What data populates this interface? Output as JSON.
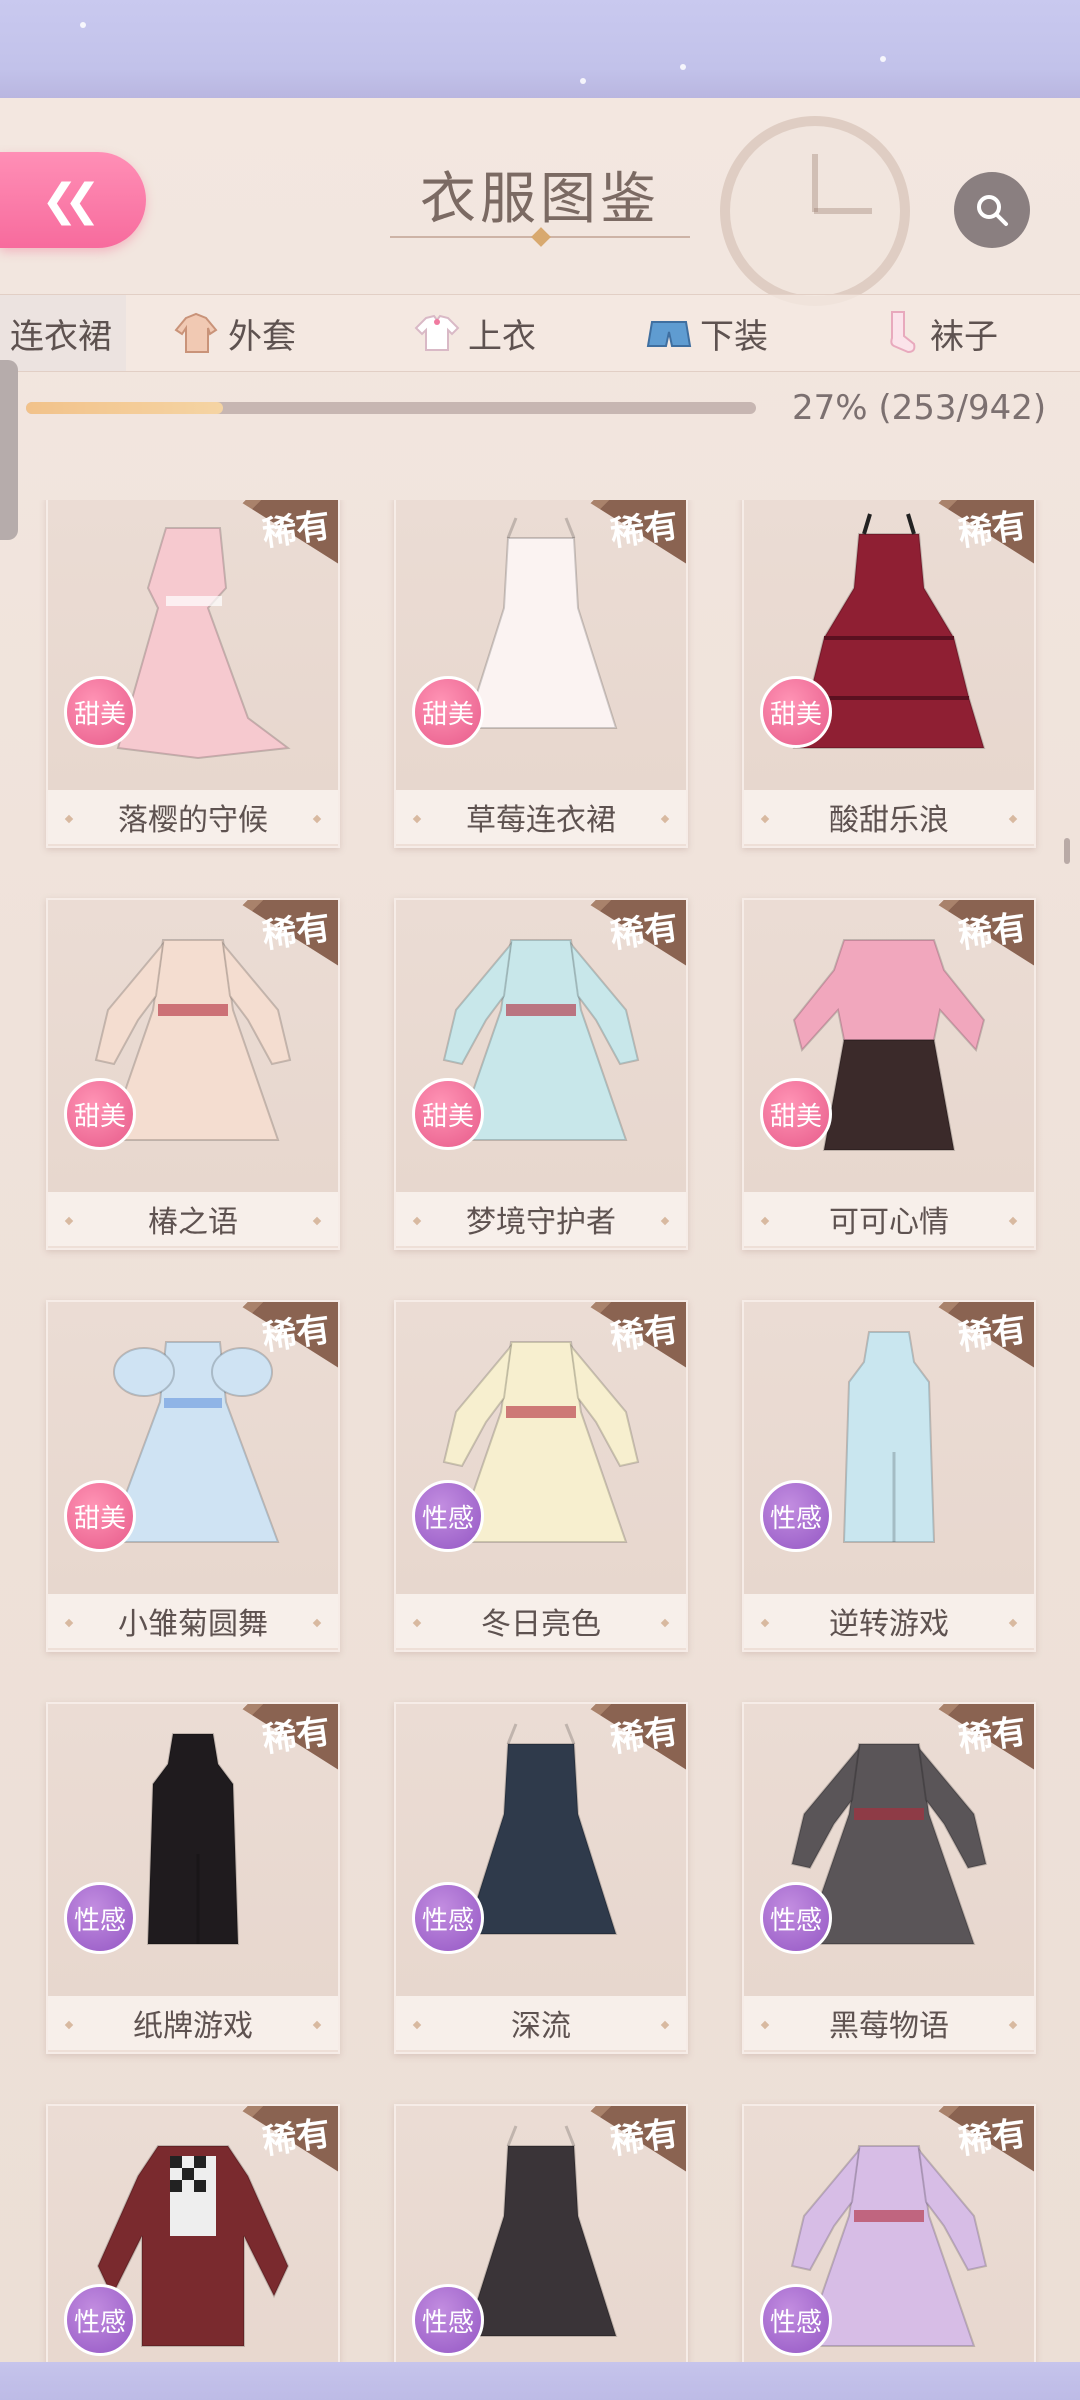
{
  "header": {
    "title": "衣服图鉴",
    "back_icon": "double-chevron-left-icon",
    "search_icon": "search-icon",
    "accent": "#f76b9d"
  },
  "tabs": [
    {
      "label": "连衣裙",
      "icon": "",
      "active": true
    },
    {
      "label": "外套",
      "icon": "coat-icon",
      "active": false
    },
    {
      "label": "上衣",
      "icon": "shirt-icon",
      "active": false
    },
    {
      "label": "下装",
      "icon": "shorts-icon",
      "active": false
    },
    {
      "label": "袜子",
      "icon": "sock-icon",
      "active": false
    }
  ],
  "progress": {
    "fraction": 0.27,
    "text": "27% (253/942)"
  },
  "rarity_label": "稀有",
  "style_colors": {
    "甜美": "#e75b8a",
    "性感": "#9457c4"
  },
  "items": [
    {
      "name": "落樱的守候",
      "style": "甜美",
      "rare": true,
      "color": "#f6c9cf",
      "shape": "dress-long"
    },
    {
      "name": "草莓连衣裙",
      "style": "甜美",
      "rare": true,
      "color": "#fbf3f2",
      "shape": "dress-short"
    },
    {
      "name": "酸甜乐浪",
      "style": "甜美",
      "rare": true,
      "color": "#8f1f33",
      "shape": "dress-tier"
    },
    {
      "name": "椿之语",
      "style": "甜美",
      "rare": true,
      "color": "#f4ddd0",
      "shape": "dress-sleeve"
    },
    {
      "name": "梦境守护者",
      "style": "甜美",
      "rare": true,
      "color": "#c8e7ea",
      "shape": "dress-sleeve"
    },
    {
      "name": "可可心情",
      "style": "甜美",
      "rare": true,
      "color": "#f1a7bd",
      "shape": "top-skirt"
    },
    {
      "name": "小雏菊圆舞",
      "style": "甜美",
      "rare": true,
      "color": "#cfe3f3",
      "shape": "dress-puff"
    },
    {
      "name": "冬日亮色",
      "style": "性感",
      "rare": true,
      "color": "#f7efcf",
      "shape": "dress-sleeve"
    },
    {
      "name": "逆转游戏",
      "style": "性感",
      "rare": true,
      "color": "#c9e6ef",
      "shape": "qipao"
    },
    {
      "name": "纸牌游戏",
      "style": "性感",
      "rare": true,
      "color": "#1f1b1e",
      "shape": "qipao"
    },
    {
      "name": "深流",
      "style": "性感",
      "rare": true,
      "color": "#2f3a4b",
      "shape": "dress-short"
    },
    {
      "name": "黑莓物语",
      "style": "性感",
      "rare": true,
      "color": "#5a5558",
      "shape": "dress-sleeve"
    },
    {
      "name": "",
      "style": "性感",
      "rare": true,
      "color": "#7a2a2e",
      "shape": "jacket"
    },
    {
      "name": "",
      "style": "性感",
      "rare": true,
      "color": "#3a3438",
      "shape": "dress-short"
    },
    {
      "name": "",
      "style": "性感",
      "rare": true,
      "color": "#d7bde6",
      "shape": "dress-sleeve"
    }
  ]
}
